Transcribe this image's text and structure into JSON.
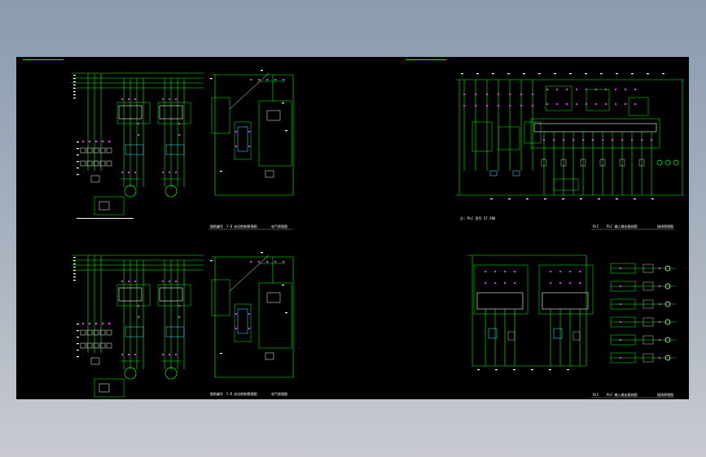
{
  "colors": {
    "background": "#000000",
    "wire": "#00ff00",
    "text": "#ffffff",
    "terminal": "#ff33ff",
    "accent": "#33ccff",
    "frame": "#33ff33"
  },
  "sheets": [
    {
      "name": "motor-control-schematic-top",
      "tb_left": "图纸编号",
      "tb_mid": "Y-D 启动控制原理图",
      "tb_right": "电气原理图"
    },
    {
      "name": "motor-control-schematic-bottom",
      "tb_left": "图纸编号",
      "tb_mid": "Y-D 启动控制原理图",
      "tb_right": "电气原理图"
    },
    {
      "name": "plc-wiring-diagram",
      "tb_left": "PLC",
      "tb_mid": "PLC 输入输出接线图",
      "tb_right": "接线原理图",
      "note": "注: PLC 型号 S7-200"
    },
    {
      "name": "io-module-diagram",
      "tb_left": "PLC",
      "tb_mid": "PLC 输入输出接线图",
      "tb_right": "接线原理图"
    }
  ]
}
